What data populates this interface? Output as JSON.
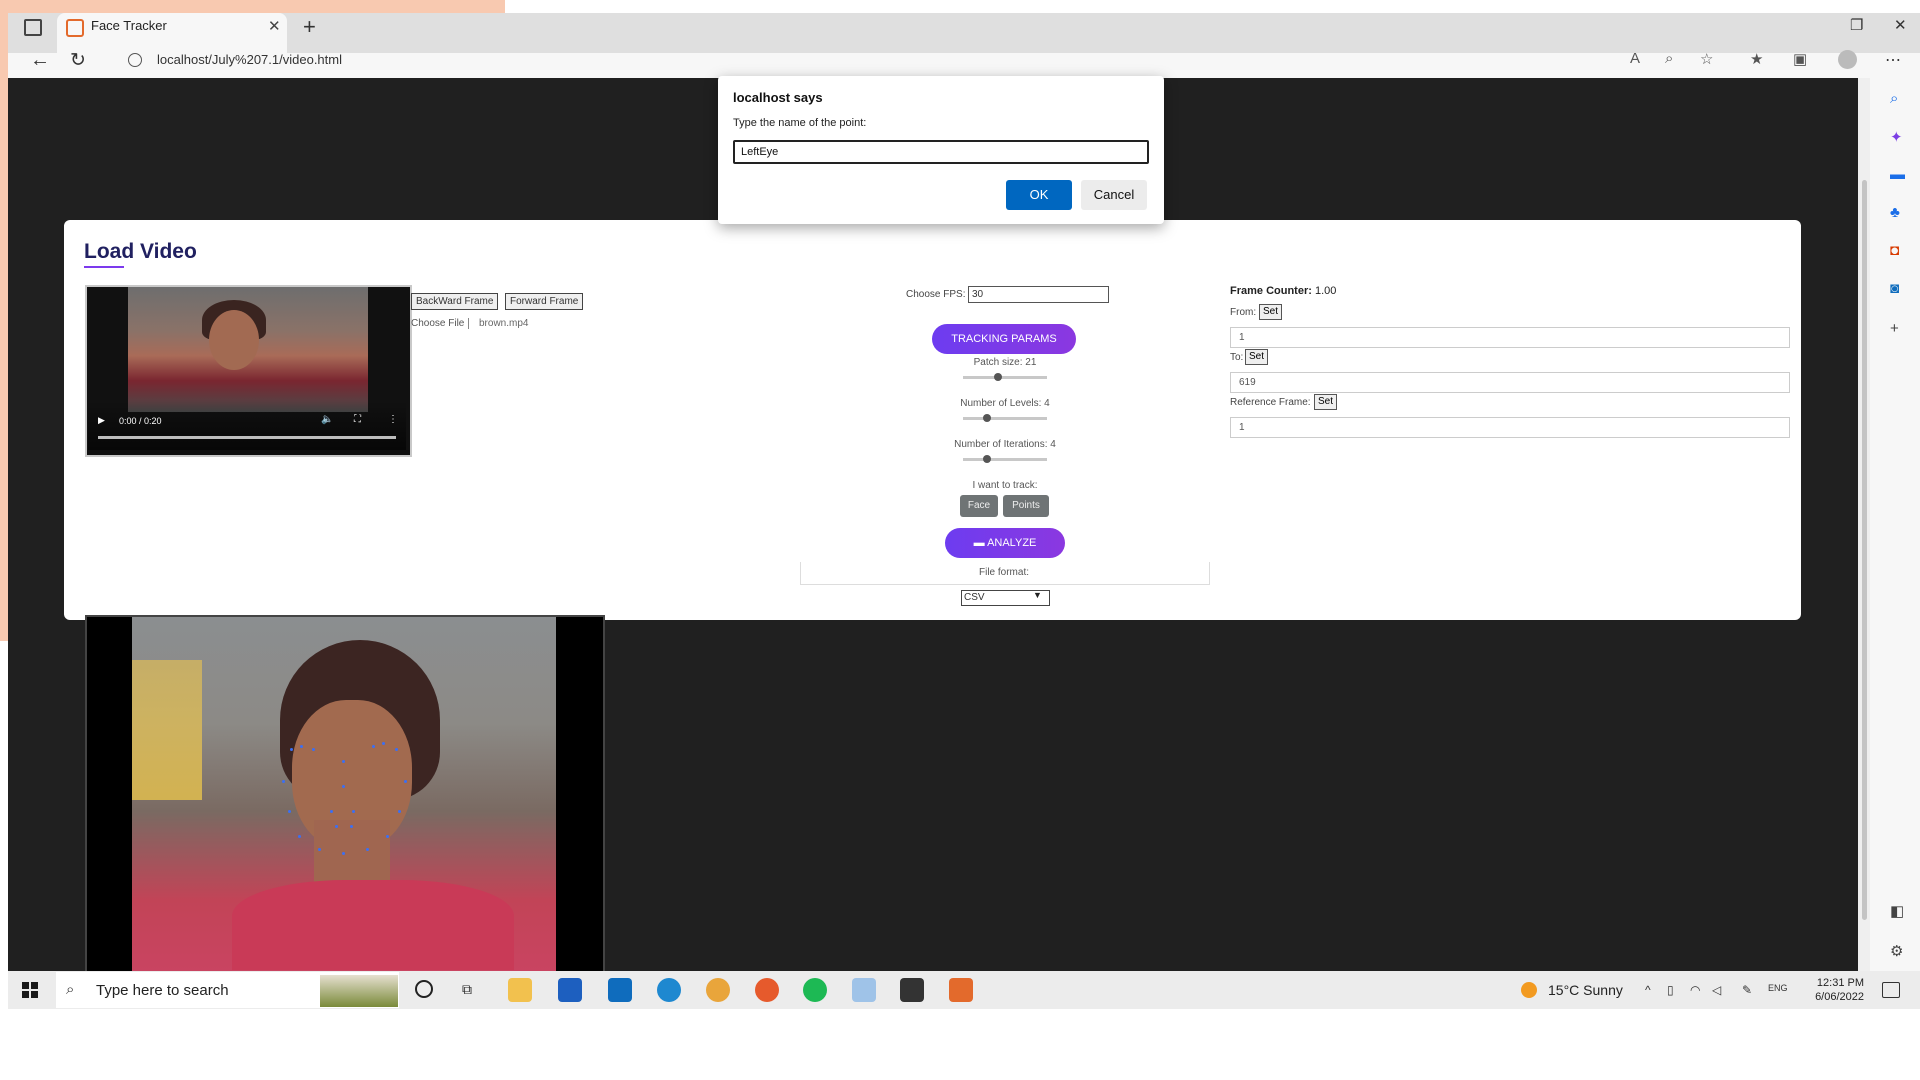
{
  "browser": {
    "tab_title": "Face Tracker",
    "url": "localhost/July%207.1/video.html",
    "tab_close_label": "✕",
    "new_tab_label": "+",
    "menu_label": "⋯"
  },
  "dialog": {
    "title": "localhost says",
    "message": "Type the name of the point:",
    "input_value": "LeftEye",
    "ok_label": "OK",
    "cancel_label": "Cancel"
  },
  "card": {
    "title": "Load Video",
    "video": {
      "time": "0:00 / 0:20"
    },
    "backward_label": "BackWard Frame",
    "forward_label": "Forward Frame",
    "choose_file_label": "Choose File",
    "file_name": "brown.mp4",
    "fps_label": "Choose FPS:",
    "fps_value": "30",
    "tracking_label": "TRACKING PARAMS",
    "patch_label": "Patch size: 21",
    "patch_fraction": 0.42,
    "levels_label": "Number of Levels: 4",
    "levels_fraction": 0.28,
    "iterations_label": "Number of Iterations: 4",
    "iterations_fraction": 0.28,
    "track_label": "I want to track:",
    "face_label": "Face",
    "points_label": "Points",
    "analyze_label": "ANALYZE",
    "file_format_label": "File format:",
    "file_format_value": "CSV",
    "frame_counter_label": "Frame Counter:",
    "frame_counter_value": "1.00",
    "from_label": "From:",
    "from_value": "1",
    "to_label": "To:",
    "to_value": "619",
    "ref_label": "Reference Frame:",
    "ref_value": "1",
    "set_label": "Set"
  },
  "taskbar": {
    "search_placeholder": "Type here to search",
    "weather": "15°C  Sunny",
    "lang": "ENG",
    "time": "12:31 PM",
    "date": "6/06/2022"
  },
  "colors": {
    "accent": "#7c3aed",
    "ok_button": "#0067c0",
    "page_bg": "#202020",
    "landmark": "#3b6ff3"
  }
}
